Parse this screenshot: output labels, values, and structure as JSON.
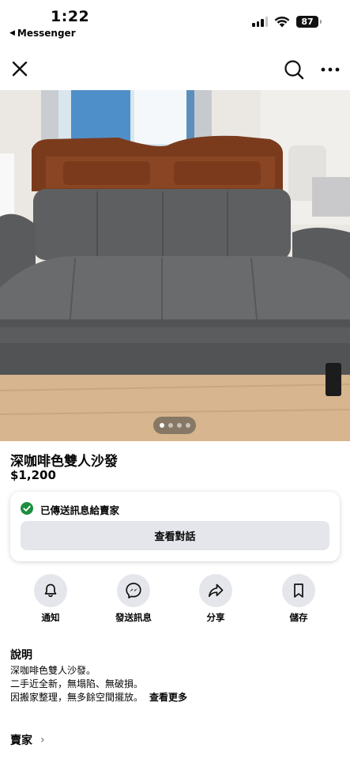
{
  "status_bar": {
    "time": "1:22",
    "back_app": "Messenger",
    "battery": "87"
  },
  "nav": {
    "close_icon": "close-icon",
    "search_icon": "search-icon",
    "more_icon": "more-icon"
  },
  "listing": {
    "title": "深咖啡色雙人沙發",
    "price": "$1,200",
    "photo_count": 4,
    "current_photo": 1
  },
  "sent_card": {
    "status": "已傳送訊息給賣家",
    "button": "查看對話",
    "accent": "#1e8e3e"
  },
  "actions": [
    {
      "label": "通知",
      "icon": "bell-icon"
    },
    {
      "label": "發送訊息",
      "icon": "messenger-icon"
    },
    {
      "label": "分享",
      "icon": "share-icon"
    },
    {
      "label": "儲存",
      "icon": "bookmark-icon"
    }
  ],
  "description": {
    "heading": "說明",
    "lines": [
      "深咖啡色雙人沙發。",
      "二手近全新，無塌陷、無破損。",
      "因搬家整理，無多餘空間擺放。"
    ],
    "more": "查看更多"
  },
  "seller": {
    "label": "賣家"
  }
}
